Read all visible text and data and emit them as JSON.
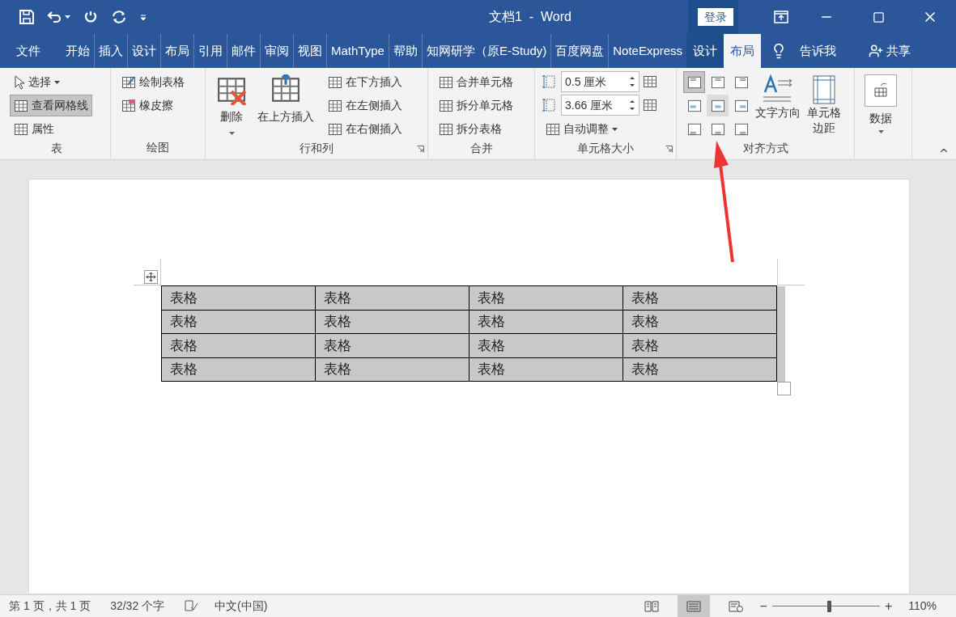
{
  "title_bar": {
    "title": "文档1  -  Word",
    "login_button": "登录"
  },
  "tabs": [
    {
      "label": "文件",
      "kind": "main",
      "selected": false
    },
    {
      "label": "开始",
      "kind": "main",
      "selected": false
    },
    {
      "label": "插入",
      "kind": "main",
      "selected": false
    },
    {
      "label": "设计",
      "kind": "main",
      "selected": false
    },
    {
      "label": "布局",
      "kind": "main",
      "selected": false
    },
    {
      "label": "引用",
      "kind": "main",
      "selected": false
    },
    {
      "label": "邮件",
      "kind": "main",
      "selected": false
    },
    {
      "label": "审阅",
      "kind": "main",
      "selected": false
    },
    {
      "label": "视图",
      "kind": "main",
      "selected": false
    },
    {
      "label": "MathType",
      "kind": "main",
      "selected": false
    },
    {
      "label": "帮助",
      "kind": "main",
      "selected": false
    },
    {
      "label": "知网研学（原E-Study)",
      "kind": "main",
      "selected": false
    },
    {
      "label": "百度网盘",
      "kind": "main",
      "selected": false
    },
    {
      "label": "NoteExpress",
      "kind": "main",
      "selected": false
    },
    {
      "label": "设计",
      "kind": "contextual",
      "selected": false
    },
    {
      "label": "布局",
      "kind": "contextual",
      "selected": true
    }
  ],
  "tell_me": "告诉我",
  "share": "共享",
  "ribbon": {
    "groups": [
      {
        "kind": "table",
        "label": "表",
        "items": [
          {
            "label": "选择",
            "dropdown": true,
            "on": false
          },
          {
            "label": "查看网格线",
            "dropdown": false,
            "on": true
          },
          {
            "label": "属性",
            "dropdown": false,
            "on": false
          }
        ]
      },
      {
        "kind": "draw",
        "label": "绘图",
        "items": [
          {
            "label": "绘制表格"
          },
          {
            "label": "橡皮擦"
          }
        ]
      },
      {
        "kind": "rows",
        "label": "行和列",
        "launcher": true,
        "large": [
          {
            "label": "删除",
            "dropdown": true
          },
          {
            "label": "在上方插入",
            "dropdown": false
          }
        ],
        "items": [
          {
            "label": "在下方插入"
          },
          {
            "label": "在左侧插入"
          },
          {
            "label": "在右侧插入"
          }
        ]
      },
      {
        "kind": "merge",
        "label": "合并",
        "items": [
          {
            "label": "合并单元格"
          },
          {
            "label": "拆分单元格"
          },
          {
            "label": "拆分表格"
          }
        ]
      },
      {
        "kind": "size",
        "label": "单元格大小",
        "launcher": true,
        "height_field": {
          "value": "0.5 厘米"
        },
        "width_field": {
          "value": "3.66 厘米"
        },
        "autofit": {
          "label": "自动调整",
          "dropdown": true
        }
      },
      {
        "kind": "align",
        "label": "对齐方式",
        "alignments": [
          {
            "selected": true,
            "highlighted": false
          },
          {
            "selected": false,
            "highlighted": false
          },
          {
            "selected": false,
            "highlighted": false
          },
          {
            "selected": false,
            "highlighted": false
          },
          {
            "selected": false,
            "highlighted": true
          },
          {
            "selected": false,
            "highlighted": false
          },
          {
            "selected": false,
            "highlighted": false
          },
          {
            "selected": false,
            "highlighted": false
          },
          {
            "selected": false,
            "highlighted": false
          }
        ],
        "large": [
          {
            "lines": [
              "文字方向"
            ]
          },
          {
            "lines": [
              "单元格",
              "边距"
            ]
          }
        ]
      },
      {
        "kind": "data",
        "large": {
          "label": "数据",
          "dropdown": true
        }
      }
    ]
  },
  "document": {
    "table": {
      "selected": true,
      "rows": [
        [
          "表格",
          "表格",
          "表格",
          "表格"
        ],
        [
          "表格",
          "表格",
          "表格",
          "表格"
        ],
        [
          "表格",
          "表格",
          "表格",
          "表格"
        ],
        [
          "表格",
          "表格",
          "表格",
          "表格"
        ]
      ]
    }
  },
  "status_bar": {
    "page": "第 1 页，共 1 页",
    "words": "32/32 个字",
    "language": "中文(中国)",
    "views": [
      {
        "kind": "read",
        "selected": false
      },
      {
        "kind": "print",
        "selected": true
      },
      {
        "kind": "web",
        "selected": false
      }
    ],
    "zoom": {
      "minus": "−",
      "plus": "+",
      "level": 0.53,
      "reading": "110%"
    }
  }
}
